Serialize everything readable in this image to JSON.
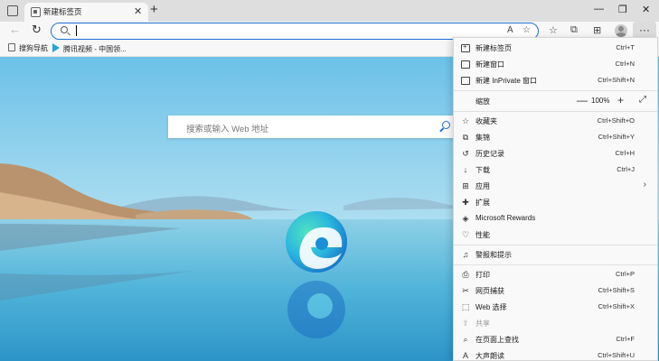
{
  "tab": {
    "title": "新建标签页",
    "close": "✕"
  },
  "new_tab_label": "+",
  "window_controls": {
    "minimize": "—",
    "restore": "❐",
    "close": "✕"
  },
  "toolbar": {
    "back": "←",
    "refresh": "↻",
    "address_value": ""
  },
  "favorites": [
    {
      "label": "搜狗导航",
      "icon": "document-icon"
    },
    {
      "label": "腾讯视频 - 中国领...",
      "icon": "play-icon"
    }
  ],
  "search": {
    "placeholder": "搜索或输入 Web 地址"
  },
  "menu": {
    "new_tab": {
      "label": "新建标签页",
      "shortcut": "Ctrl+T"
    },
    "new_window": {
      "label": "新建窗口",
      "shortcut": "Ctrl+N"
    },
    "new_inprivate": {
      "label": "新建 InPrivate 窗口",
      "shortcut": "Ctrl+Shift+N"
    },
    "zoom": {
      "label": "缩放",
      "value": "100%",
      "minus": "—",
      "plus": "+"
    },
    "favorites": {
      "label": "收藏夹",
      "shortcut": "Ctrl+Shift+O"
    },
    "collections": {
      "label": "集锦",
      "shortcut": "Ctrl+Shift+Y"
    },
    "history": {
      "label": "历史记录",
      "shortcut": "Ctrl+H"
    },
    "downloads": {
      "label": "下载",
      "shortcut": "Ctrl+J"
    },
    "apps": {
      "label": "应用"
    },
    "extensions": {
      "label": "扩展"
    },
    "rewards": {
      "label": "Microsoft Rewards"
    },
    "performance": {
      "label": "性能"
    },
    "alerts": {
      "label": "警报和提示"
    },
    "print": {
      "label": "打印",
      "shortcut": "Ctrl+P"
    },
    "web_capture": {
      "label": "网页捕获",
      "shortcut": "Ctrl+Shift+S"
    },
    "web_select": {
      "label": "Web 选择",
      "shortcut": "Ctrl+Shift+X"
    },
    "share": {
      "label": "共享"
    },
    "find": {
      "label": "在页面上查找",
      "shortcut": "Ctrl+F"
    },
    "read_aloud": {
      "label": "大声朗读",
      "shortcut": "Ctrl+Shift+U"
    }
  },
  "colors": {
    "accent": "#1f6ed4",
    "menu_bg": "#f9f9f9",
    "tab_strip": "#dedede"
  }
}
